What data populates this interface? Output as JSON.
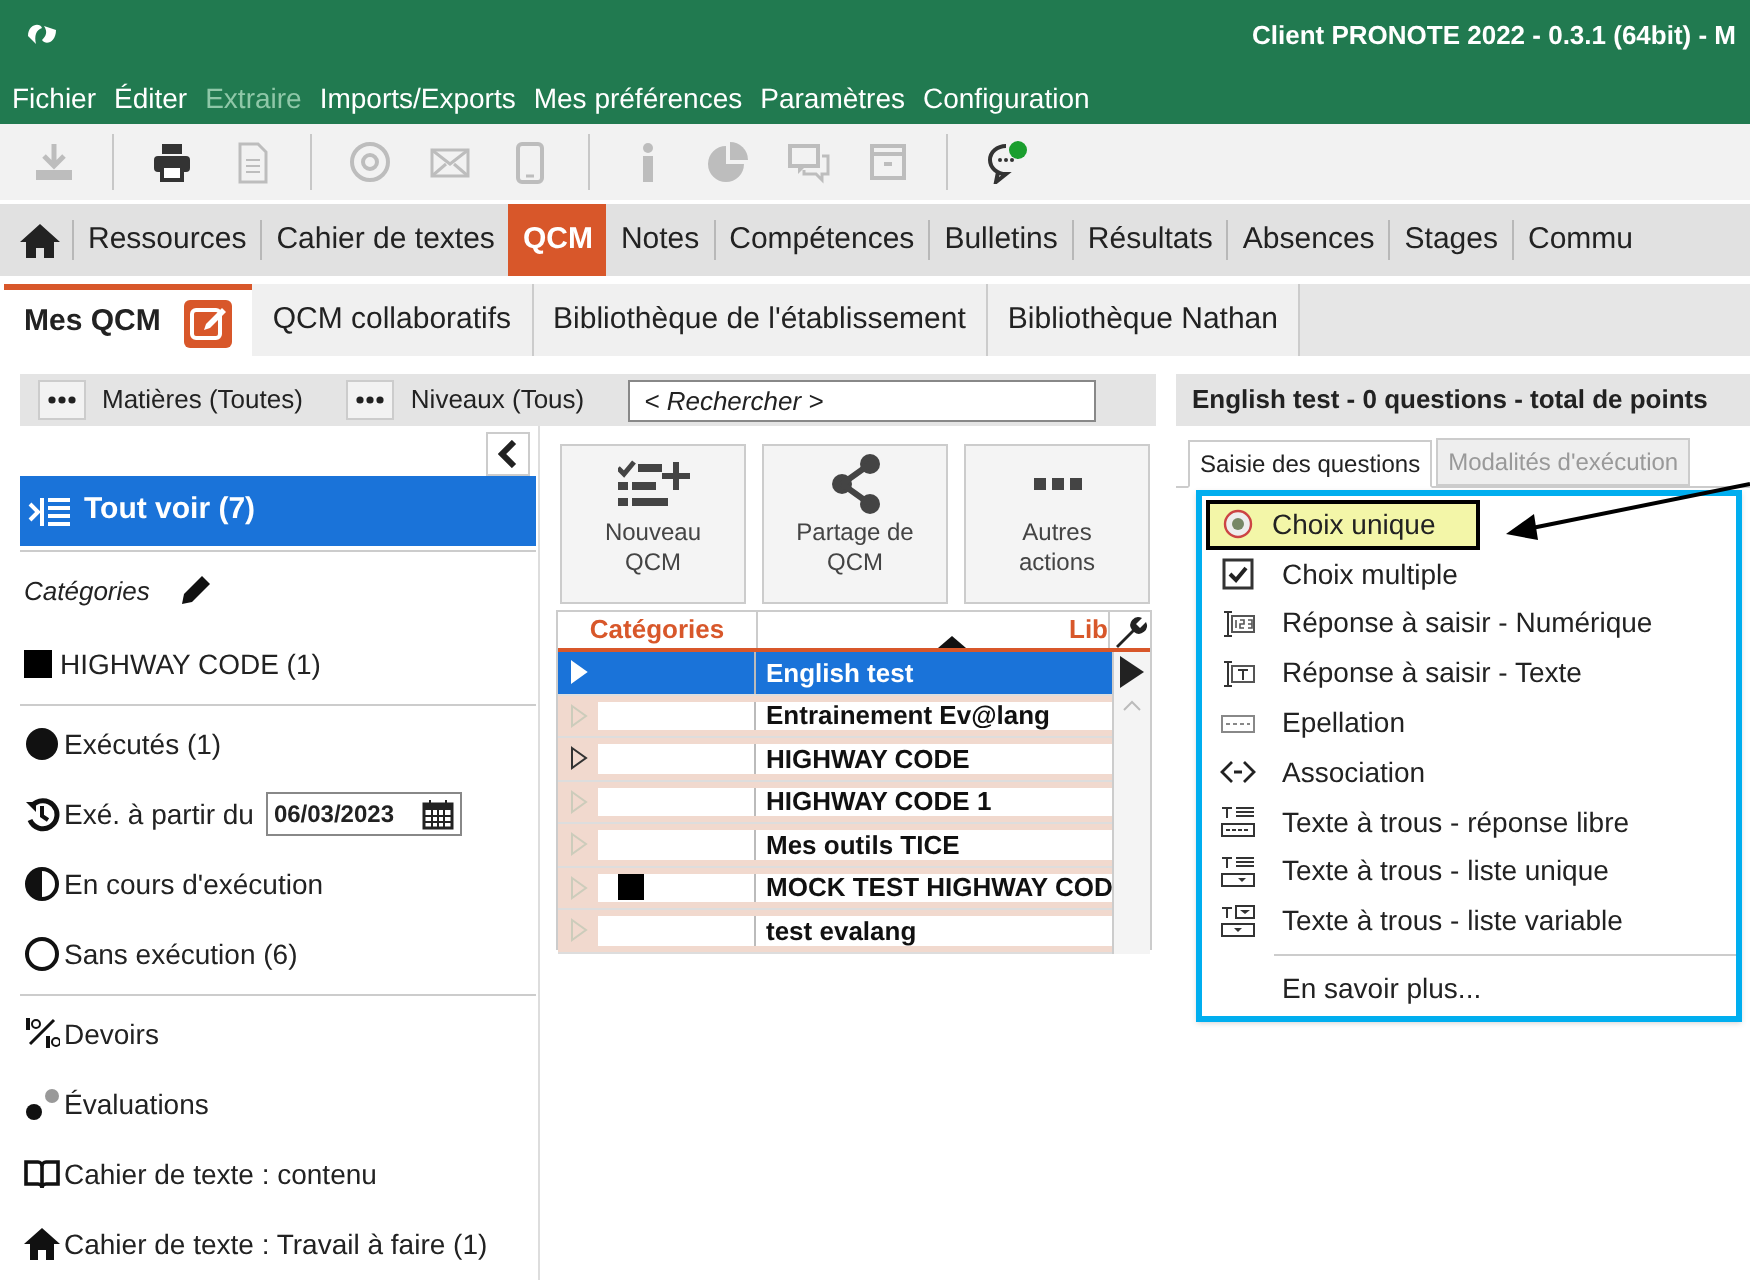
{
  "window": {
    "title": "Client PRONOTE 2022 - 0.3.1 (64bit) - M"
  },
  "menu_bar": [
    {
      "label": "Fichier",
      "disabled": false
    },
    {
      "label": "Éditer",
      "disabled": false
    },
    {
      "label": "Extraire",
      "disabled": true
    },
    {
      "label": "Imports/Exports",
      "disabled": false
    },
    {
      "label": "Mes préférences",
      "disabled": false
    },
    {
      "label": "Paramètres",
      "disabled": false
    },
    {
      "label": "Configuration",
      "disabled": false
    }
  ],
  "toolbar": [
    {
      "disabled": true
    },
    {
      "disabled": false
    },
    {
      "disabled": true
    },
    {
      "disabled": true
    },
    {
      "disabled": true
    },
    {
      "disabled": true
    },
    {
      "disabled": true
    },
    {
      "disabled": true
    },
    {
      "disabled": true
    },
    {
      "disabled": true
    },
    {
      "disabled": false
    }
  ],
  "module_tabs": [
    {
      "label": "Ressources",
      "selected": false
    },
    {
      "label": "Cahier de textes",
      "selected": false
    },
    {
      "label": "QCM",
      "selected": true
    },
    {
      "label": "Notes",
      "selected": false
    },
    {
      "label": "Compétences",
      "selected": false
    },
    {
      "label": "Bulletins",
      "selected": false
    },
    {
      "label": "Résultats",
      "selected": false
    },
    {
      "label": "Absences",
      "selected": false
    },
    {
      "label": "Stages",
      "selected": false
    },
    {
      "label": "Commu",
      "selected": false
    }
  ],
  "sub_tabs": [
    {
      "label": "Mes QCM",
      "selected": true
    },
    {
      "label": "QCM collaboratifs",
      "selected": false
    },
    {
      "label": "Bibliothèque de l'établissement",
      "selected": false
    },
    {
      "label": "Bibliothèque Nathan",
      "selected": false
    }
  ],
  "filters": {
    "subjects": "Matières (Toutes)",
    "levels": "Niveaux (Tous)",
    "search": {
      "placeholder": "< Rechercher >"
    }
  },
  "sidebar": {
    "show_all": {
      "label": "Tout voir (7)",
      "selected": true
    },
    "categories_heading": "Catégories",
    "categories": [
      {
        "label": "HIGHWAY CODE (1)",
        "color": "#000000"
      }
    ],
    "status_filters": [
      {
        "label": "Exécutés (1)"
      },
      {
        "label": "Exé. à partir du",
        "date": "06/03/2023"
      },
      {
        "label": "En cours d'exécution"
      },
      {
        "label": "Sans exécution (6)"
      }
    ],
    "links": [
      {
        "label": "Devoirs"
      },
      {
        "label": "Évaluations"
      },
      {
        "label": "Cahier de texte : contenu"
      },
      {
        "label": "Cahier de texte : Travail à faire (1)"
      }
    ]
  },
  "actions": [
    {
      "label": "Nouveau QCM"
    },
    {
      "label": "Partage de QCM"
    },
    {
      "label": "Autres actions"
    }
  ],
  "table": {
    "columns": [
      "Catégories",
      "Lib"
    ],
    "rows": [
      {
        "label": "English test",
        "selected": true,
        "current": false
      },
      {
        "label": "Entrainement Ev@lang",
        "selected": false,
        "current": false
      },
      {
        "label": "HIGHWAY CODE",
        "selected": false,
        "current": true
      },
      {
        "label": "HIGHWAY CODE 1",
        "selected": false,
        "current": false
      },
      {
        "label": "Mes outils TICE",
        "selected": false,
        "current": false
      },
      {
        "label": "MOCK TEST HIGHWAY COD",
        "selected": false,
        "current": false,
        "color": "#000000"
      },
      {
        "label": "test evalang",
        "selected": false,
        "current": false
      }
    ]
  },
  "detail": {
    "header": "English test - 0 questions - total de points",
    "tabs": [
      {
        "label": "Saisie des questions",
        "selected": true,
        "disabled": false
      },
      {
        "label": "Modalités d'exécution",
        "selected": false,
        "disabled": true
      }
    ],
    "question_type_menu": [
      {
        "label": "Choix unique",
        "selected": true
      },
      {
        "label": "Choix multiple",
        "selected": false
      },
      {
        "label": "Réponse à saisir - Numérique",
        "selected": false
      },
      {
        "label": "Réponse à saisir - Texte",
        "selected": false
      },
      {
        "label": "Epellation",
        "selected": false
      },
      {
        "label": "Association",
        "selected": false
      },
      {
        "label": "Texte à trous - réponse libre",
        "selected": false
      },
      {
        "label": "Texte à trous - liste unique",
        "selected": false
      },
      {
        "label": "Texte à trous - liste variable",
        "selected": false
      }
    ],
    "more_link": "En savoir plus..."
  }
}
